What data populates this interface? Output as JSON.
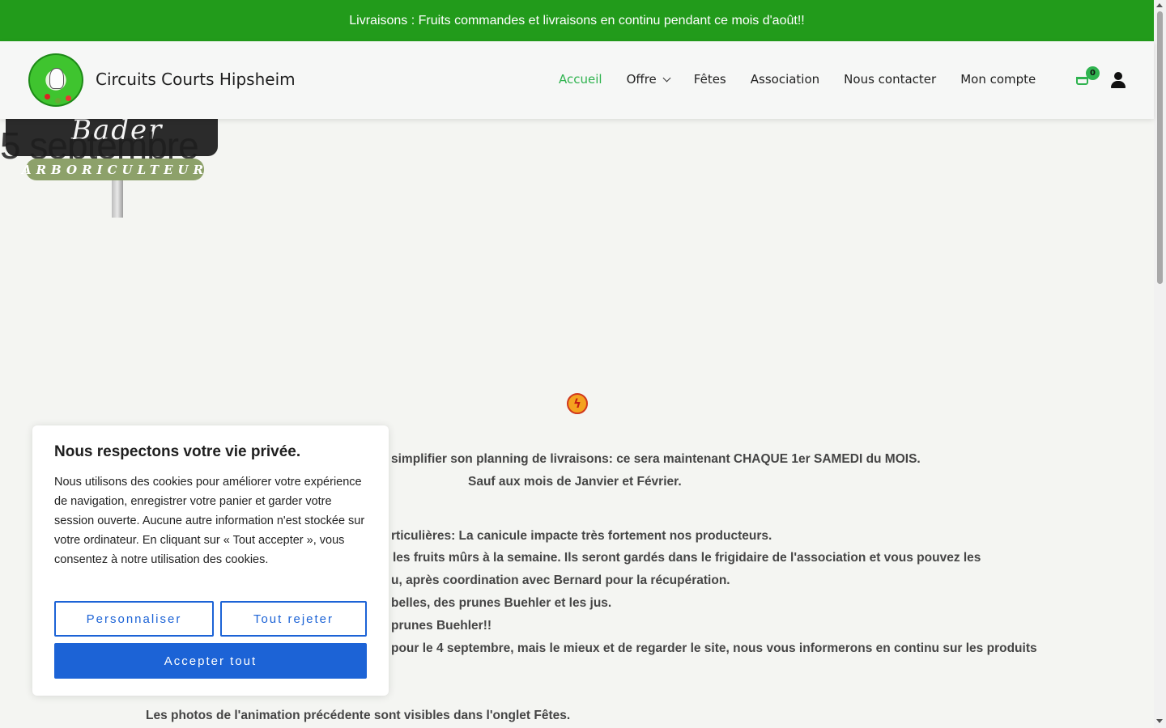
{
  "topbar": {
    "text": "Livraisons : Fruits commandes et livraisons en continu pendant ce mois d'août!!"
  },
  "header": {
    "site_title": "Circuits Courts Hipsheim",
    "nav": [
      "Accueil",
      "Offre",
      "Fêtes",
      "Association",
      "Nous contacter",
      "Mon compte"
    ],
    "cart_count": "0"
  },
  "hero": {
    "sign_name": "Bader",
    "sign_overlay": "5 septembre",
    "sign_tag": "ARBORICULTEUR"
  },
  "content": {
    "icon": "lightning-icon",
    "lines": [
      "simplifier son planning de livraisons: ce sera maintenant CHAQUE 1er SAMEDI du MOIS.",
      "Sauf aux mois de Janvier et Février.",
      "rticulières: La canicule impacte très fortement nos producteurs.",
      "les fruits mûrs à la semaine. Ils seront gardés dans le frigidaire de l'association et vous pouvez les",
      "u, après coordination avec Bernard pour la récupération.",
      "belles, des prunes Buehler et les jus.",
      "prunes Buehler!!",
      "pour le 4 septembre, mais le mieux et de regarder le site, nous vous informerons en continu sur les produits",
      "Les photos de l'animation précédente sont visibles dans l'onglet Fêtes."
    ]
  },
  "cookie": {
    "title": "Nous respectons votre vie privée.",
    "text": "Nous utilisons des cookies pour améliorer votre expérience de navigation, enregistrer votre panier et garder votre session ouverte. Aucune autre information n'est stockée sur votre ordinateur. En cliquant sur « Tout accepter », vous consentez à notre utilisation des cookies.",
    "customize": "Personnaliser",
    "reject": "Tout rejeter",
    "accept": "Accepter tout"
  },
  "colors": {
    "topbar": "#229b1b",
    "accent": "#2fb34f",
    "button": "#1c63d6"
  }
}
